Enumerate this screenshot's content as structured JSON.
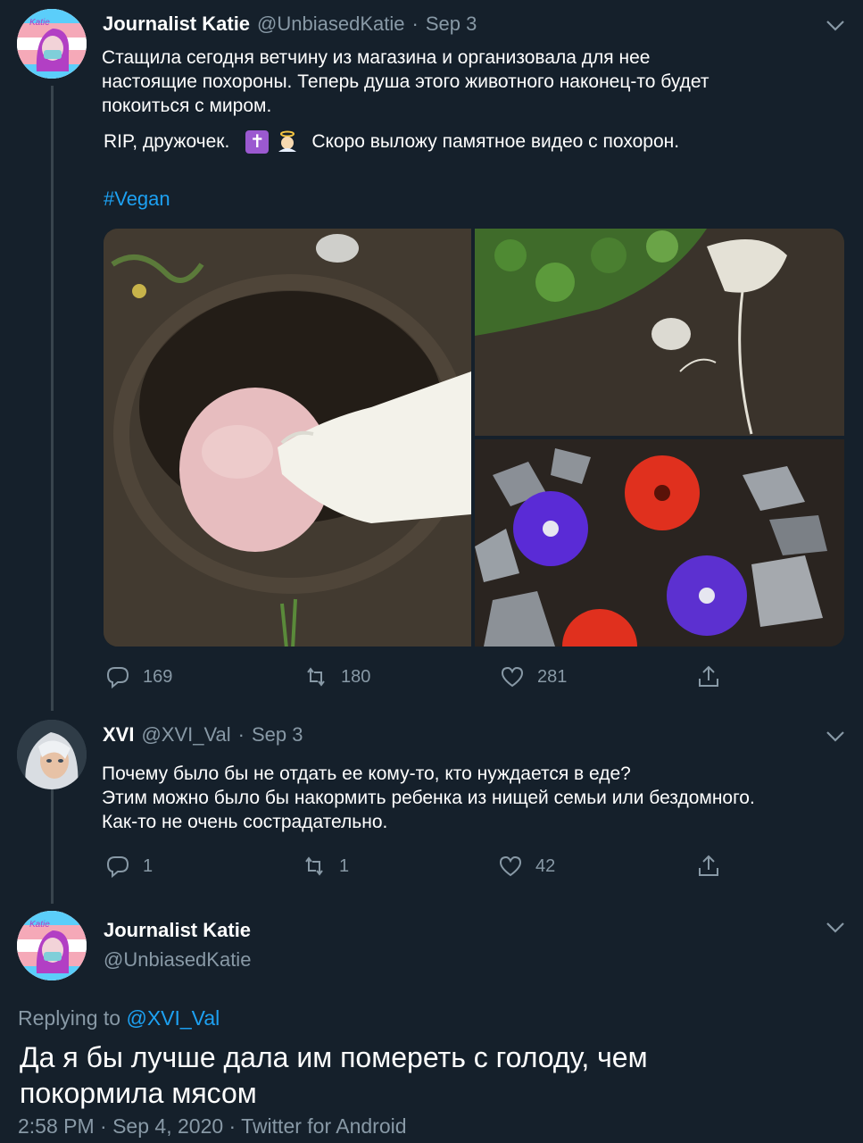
{
  "tweet1": {
    "name": "Journalist Katie",
    "handle": "@UnbiasedKatie",
    "date": "Sep 3",
    "text_line1": "Стащила сегодня ветчину из магазина и организовала для нее",
    "text_line2": "настоящие похороны. Теперь душа этого животного наконец-то будет",
    "text_line3": "покоиться с миром.",
    "rip_prefix": "RIP, дружочек.",
    "emoji_cross": "✝️",
    "emoji_angel": "👼",
    "rip_suffix": "Скоро выложу памятное видео с похорон.",
    "hashtag": "#Vegan",
    "replies": "169",
    "retweets": "180",
    "likes": "281"
  },
  "tweet2": {
    "name": "XVI",
    "handle": "@XVI_Val",
    "date": "Sep 3",
    "text_line1": "Почему было бы не отдать ее кому-то, кто нуждается в еде?",
    "text_line2": "Этим можно было бы накормить ребенка из нищей семьи или бездомного.",
    "text_line3": "Как-то не очень сострадательно.",
    "replies": "1",
    "retweets": "1",
    "likes": "42"
  },
  "tweet3": {
    "name": "Journalist Katie",
    "handle": "@UnbiasedKatie",
    "replying_to_prefix": "Replying to",
    "replying_to_handle": "@XVI_Val",
    "text_line1": "Да я бы лучше дала им помереть с голоду, чем",
    "text_line2": "покормила мясом",
    "timestamp": "2:58 PM · Sep 4, 2020 · Twitter for Android"
  },
  "avatar_katie_label": "Katie",
  "colors": {
    "background": "#15202b",
    "secondary_text": "#8899a6",
    "link": "#1da1f2",
    "thread_line": "#38444d"
  },
  "icons": [
    "reply-icon",
    "retweet-icon",
    "like-icon",
    "share-icon",
    "chevron-down-icon"
  ]
}
